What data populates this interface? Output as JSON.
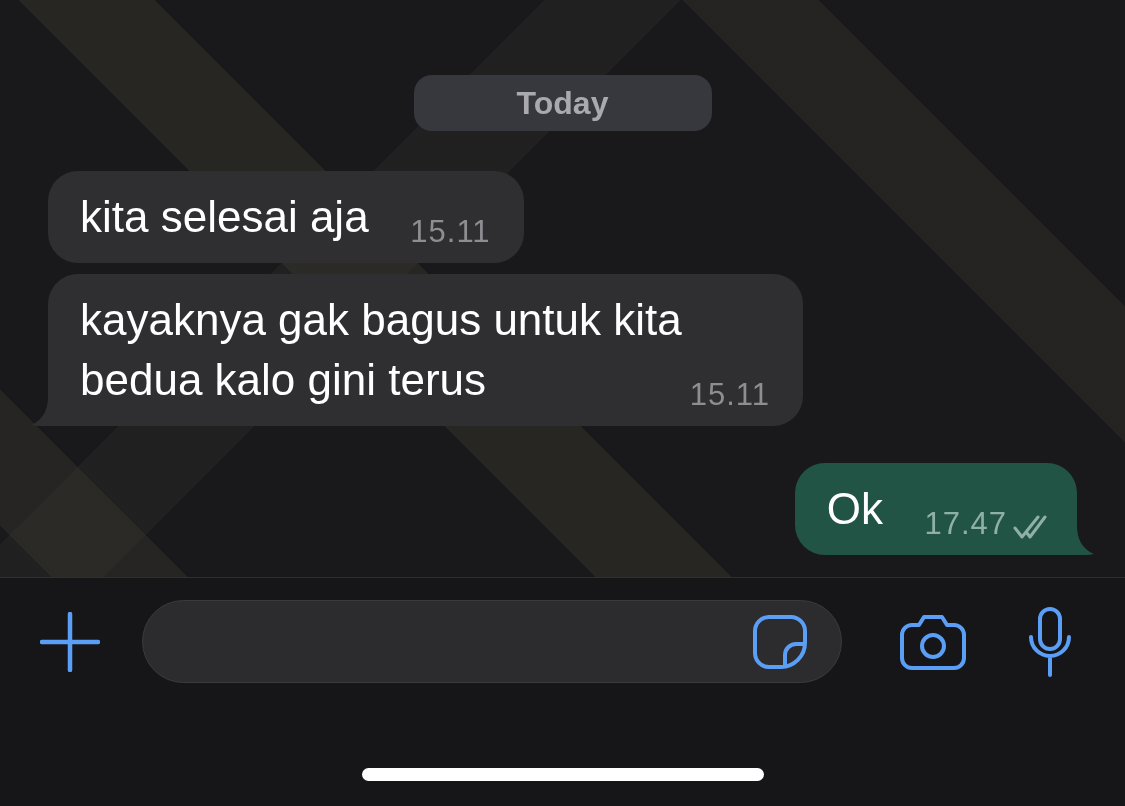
{
  "date_label": "Today",
  "messages": [
    {
      "kind": "incoming",
      "text": "kita selesai aja",
      "time": "15.11",
      "tail": false
    },
    {
      "kind": "incoming",
      "text": "kayaknya gak bagus untuk kita bedua kalo gini terus",
      "time": "15.11",
      "tail": true
    },
    {
      "kind": "outgoing",
      "text": "Ok",
      "time": "17.47",
      "tail": true,
      "delivered": true,
      "read": false
    }
  ]
}
